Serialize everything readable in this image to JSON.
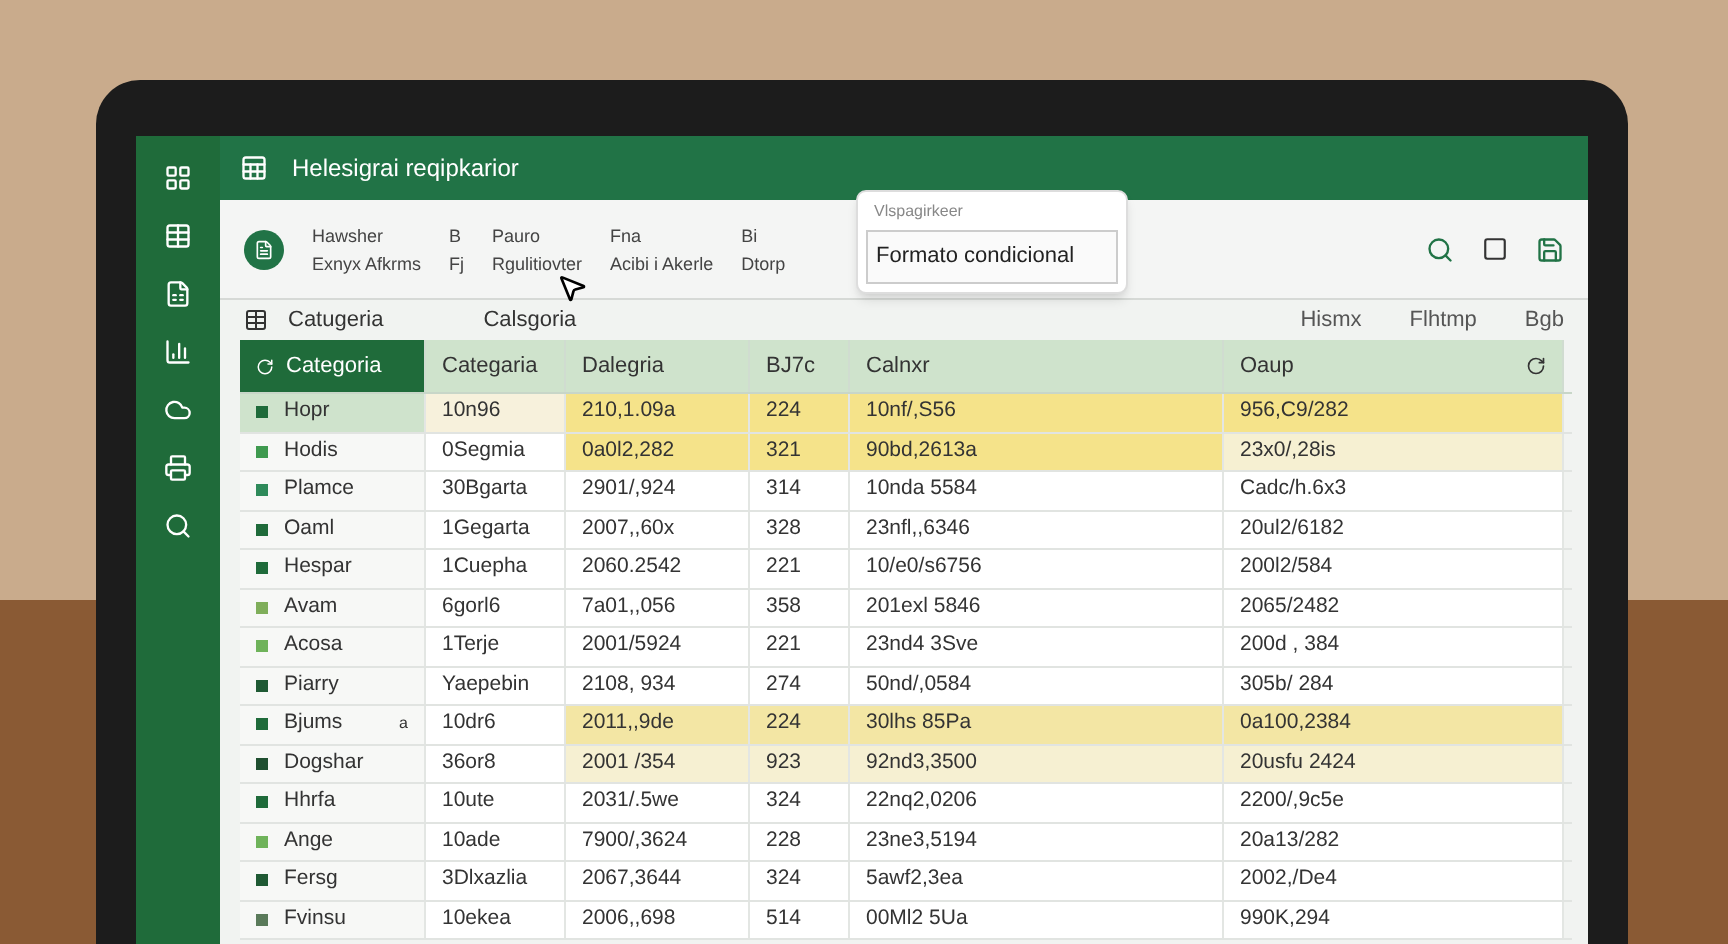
{
  "window": {
    "title": "Helesigrai reqipkarior"
  },
  "ribbon": {
    "groups": [
      {
        "top": "Hawsher",
        "bottom": "Exnyx Afkrms"
      },
      {
        "top": "B",
        "bottom": "Fj"
      },
      {
        "top": "Pauro",
        "bottom": "Rgulitiovter"
      },
      {
        "top": "Fna",
        "bottom": "Acibi i Akerle"
      },
      {
        "top": "Bi",
        "bottom": "Dtorp"
      }
    ]
  },
  "dropdown": {
    "header": "Vlspagirkeer",
    "items": [
      {
        "label": "Formato condicional",
        "selected": true
      }
    ]
  },
  "subbar": {
    "left": [
      "Catugeria",
      "Calsgoria"
    ],
    "right": [
      "Hismx",
      "Flhtmp",
      "Bgb"
    ]
  },
  "table": {
    "columns": [
      "Categoria",
      "Categaria",
      "Dalegria",
      "BJ7c",
      "Calnxr",
      "Oaup"
    ],
    "rows": [
      {
        "selected": true,
        "kind": "strong",
        "color": "#1f6b3a",
        "cells": [
          "Hopr",
          "10n96",
          "210,1.09a",
          "224",
          "10nf/,S56",
          "956,C9/282"
        ]
      },
      {
        "selected": false,
        "kind": "strong",
        "color": "#3f9a4f",
        "cells": [
          "Hodis",
          "0Segmia",
          "0a0l2,282",
          "321",
          "90bd,2613a",
          "23x0/,28is"
        ]
      },
      {
        "selected": false,
        "kind": "plain",
        "color": "#2e8a5a",
        "cells": [
          "Plamce",
          "30Bgarta",
          "2901/,924",
          "314",
          "10nda 5584",
          "Cadc/h.6x3"
        ]
      },
      {
        "selected": false,
        "kind": "plain",
        "color": "#1f6b3a",
        "cells": [
          "Oaml",
          "1Gegarta",
          "2007,,60x",
          "328",
          "23nfl,,6346",
          "20ul2/6182"
        ]
      },
      {
        "selected": false,
        "kind": "plain",
        "color": "#1f6b3a",
        "cells": [
          "Hespar",
          "1Cuepha",
          "2060.2542",
          "221",
          "10/e0/s6756",
          "200l2/584"
        ]
      },
      {
        "selected": false,
        "kind": "plain",
        "color": "#7fae5a",
        "cells": [
          "Avam",
          "6gorl6",
          "7a01,,056",
          "358",
          "201exl 5846",
          "2065/2482"
        ]
      },
      {
        "selected": false,
        "kind": "plain",
        "color": "#6fb35a",
        "cells": [
          "Acosa",
          "1Terje",
          "2001/5924",
          "221",
          "23nd4 3Sve",
          "200d , 384"
        ]
      },
      {
        "selected": false,
        "kind": "plain",
        "color": "#1f5a34",
        "cells": [
          "Piarry",
          "Yaepebin",
          "2108, 934",
          "274",
          "50nd/,0584",
          "305b/ 284"
        ]
      },
      {
        "selected": false,
        "kind": "medium",
        "color": "#1f6b3a",
        "marker": "a",
        "cells": [
          "Bjums",
          "10dr6",
          "2011,,9de",
          "224",
          "30lhs 85Pa",
          "0a100,2384"
        ]
      },
      {
        "selected": false,
        "kind": "light",
        "color": "#1f4f30",
        "cells": [
          "Dogshar",
          "36or8",
          "2001 /354",
          "923",
          "92nd3,3500",
          "20usfu 2424"
        ]
      },
      {
        "selected": false,
        "kind": "plain",
        "color": "#1f6b3a",
        "cells": [
          "Hhrfa",
          "10ute",
          "2031/.5we",
          "324",
          "22nq2,0206",
          "2200/,9c5e"
        ]
      },
      {
        "selected": false,
        "kind": "plain",
        "color": "#6fb35a",
        "cells": [
          "Ange",
          "10ade",
          "7900/,3624",
          "228",
          "23ne3,5194",
          "20a13/282"
        ]
      },
      {
        "selected": false,
        "kind": "plain",
        "color": "#1f5a34",
        "cells": [
          "Fersg",
          "3Dlxazlia",
          "2067,3644",
          "324",
          "5awf2,3ea",
          "2002,/De4"
        ]
      },
      {
        "selected": false,
        "kind": "plain",
        "color": "#5a7a5a",
        "cells": [
          "Fvinsu",
          "10ekea",
          "2006,,698",
          "514",
          "00Ml2 5Ua",
          "990K,294"
        ]
      }
    ]
  }
}
